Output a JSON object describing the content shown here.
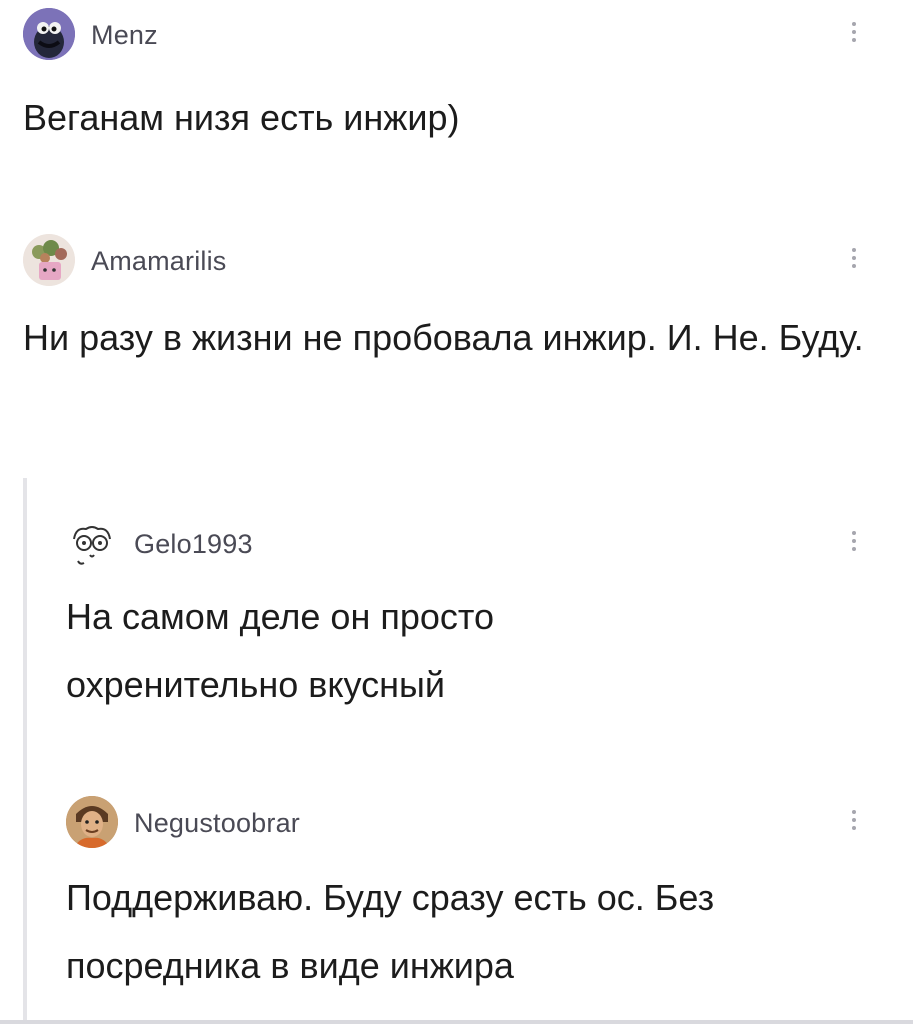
{
  "comments": [
    {
      "username": "Menz",
      "avatar_icon": "cookie-monster-avatar",
      "text": "Веганам низя есть инжир)"
    },
    {
      "username": "Amamarilis",
      "avatar_icon": "flower-pot-avatar",
      "text": "Ни разу в жизни не пробовала инжир. И. Не. Буду."
    },
    {
      "username": "Gelo1993",
      "avatar_icon": "cartoon-face-avatar",
      "text": "На самом деле он просто охренительно вкусный"
    },
    {
      "username": "Negustoobrar",
      "avatar_icon": "portrait-avatar",
      "text": "Поддерживаю. Буду сразу есть ос. Без посредника в виде инжира"
    }
  ],
  "menu_icon": "more-vertical-icon"
}
